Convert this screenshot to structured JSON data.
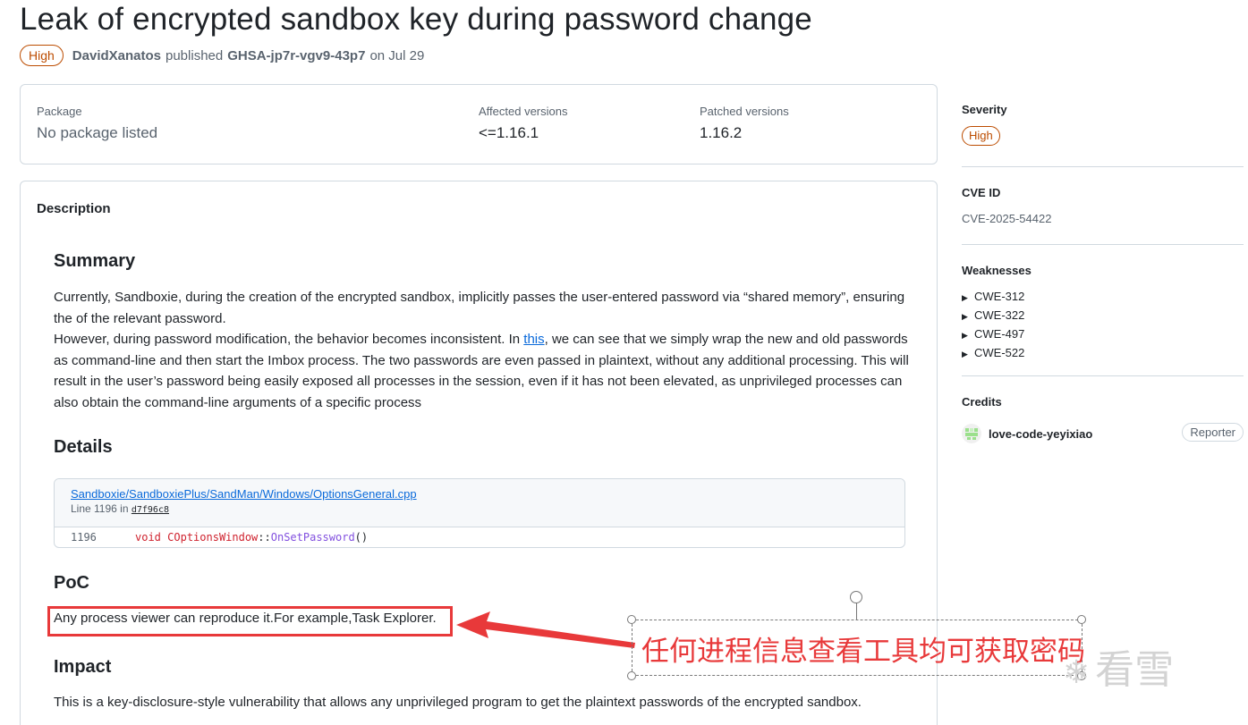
{
  "header": {
    "title": "Leak of encrypted sandbox key during password change",
    "severity_badge": "High",
    "author": "DavidXanatos",
    "published_text": "published",
    "ghsa_id": "GHSA-jp7r-vgv9-43p7",
    "date_text": "on Jul 29"
  },
  "package": {
    "package_label": "Package",
    "package_value": "No package listed",
    "affected_label": "Affected versions",
    "affected_value": "<=1.16.1",
    "patched_label": "Patched versions",
    "patched_value": "1.16.2"
  },
  "description": {
    "header": "Description",
    "summary_heading": "Summary",
    "summary_p1": "Currently, Sandboxie, during the creation of the encrypted sandbox, implicitly passes the user-entered password via “shared memory”, ensuring the of the relevant password.",
    "summary_p2_before": "However, during password modification, the behavior becomes inconsistent. In ",
    "summary_p2_link": "this",
    "summary_p2_after": ", we can see that we simply wrap the new and old passwords as command-line and then start the Imbox process. The two passwords are even passed in plaintext, without any additional processing. This will result in the user’s password being easily exposed all processes in the session, even if it has not been elevated, as unprivileged processes can also obtain the command-line arguments of a specific process",
    "details_heading": "Details",
    "code_file": "Sandboxie/SandboxiePlus/SandMan/Windows/OptionsGeneral.cpp",
    "code_line_prefix": "Line 1196 in",
    "code_commit": "d7f96c8",
    "code_line_number": "1196",
    "code_keyword": "void",
    "code_class": "COptionsWindow",
    "code_sep": "::",
    "code_method": "OnSetPassword",
    "code_parens": "()",
    "poc_heading": "PoC",
    "poc_text": "Any process viewer can reproduce it.For example,Task Explorer.",
    "impact_heading": "Impact",
    "impact_text": "This is a key-disclosure-style vulnerability that allows any unprivileged program to get the plaintext passwords of the encrypted sandbox."
  },
  "sidebar": {
    "severity_label": "Severity",
    "severity_value": "High",
    "cve_label": "CVE ID",
    "cve_value": "CVE-2025-54422",
    "weaknesses_label": "Weaknesses",
    "weaknesses": [
      "CWE-312",
      "CWE-322",
      "CWE-497",
      "CWE-522"
    ],
    "credits_label": "Credits",
    "credit_user": "love-code-yeyixiao",
    "credit_role": "Reporter"
  },
  "annotation": {
    "text": "任何进程信息查看工具均可获取密码",
    "color": "#e8393a"
  },
  "watermark": {
    "text": "看雪"
  },
  "colors": {
    "severity_high": "#bc4c00",
    "link": "#0969da",
    "border": "#d1d9e0"
  }
}
